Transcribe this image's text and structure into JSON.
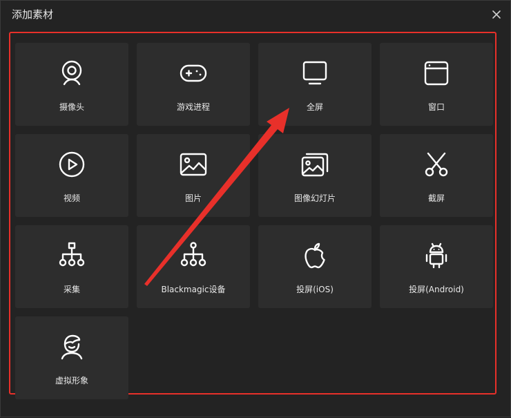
{
  "dialog": {
    "title": "添加素材"
  },
  "sources": [
    {
      "label": "摄像头",
      "icon": "webcam-icon"
    },
    {
      "label": "游戏进程",
      "icon": "gamepad-icon"
    },
    {
      "label": "全屏",
      "icon": "monitor-icon"
    },
    {
      "label": "窗口",
      "icon": "window-icon"
    },
    {
      "label": "视频",
      "icon": "play-icon"
    },
    {
      "label": "图片",
      "icon": "image-icon"
    },
    {
      "label": "图像幻灯片",
      "icon": "slideshow-icon"
    },
    {
      "label": "截屏",
      "icon": "scissors-icon"
    },
    {
      "label": "采集",
      "icon": "capture-tree-icon"
    },
    {
      "label": "Blackmagic设备",
      "icon": "blackmagic-tree-icon"
    },
    {
      "label": "投屏(iOS)",
      "icon": "apple-icon"
    },
    {
      "label": "投屏(Android)",
      "icon": "android-icon"
    },
    {
      "label": "虚拟形象",
      "icon": "avatar-icon"
    }
  ],
  "colors": {
    "highlight": "#e8302a",
    "tile": "#2d2d2d",
    "icon": "#ffffff"
  }
}
